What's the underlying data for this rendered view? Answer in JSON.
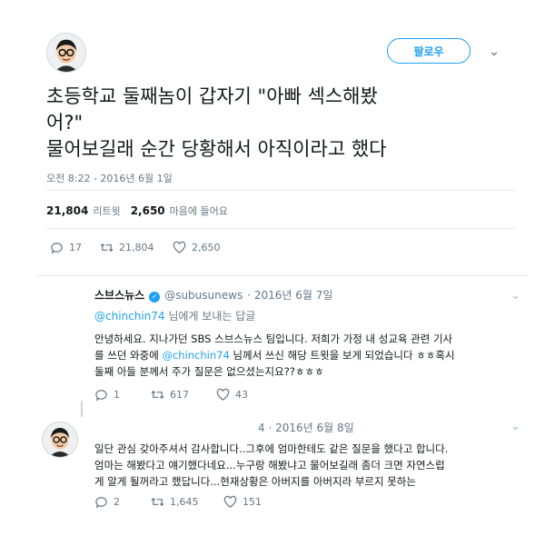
{
  "header": {
    "follow_label": "팔로우",
    "chevron_glyph": "⌄"
  },
  "tweet": {
    "text_lines": [
      "초등학교 둘째놈이 갑자기  \"아빠  섹스해봤",
      "어?\"",
      "물어보길래 순간 당황해서  아직이라고 했다"
    ],
    "timestamp": "오전 8:22 - 2016년 6월 1일",
    "stats": {
      "retweets": "21,804",
      "retweets_label": "리트윗",
      "likes": "2,650",
      "likes_label": "마음에 들어요"
    },
    "actions": {
      "replies": "17",
      "retweets": "21,804",
      "likes": "2,650"
    }
  },
  "reply1": {
    "name": "스브스뉴스",
    "handle": "@subusunews",
    "date": "· 2016년 6월 7일",
    "reply_to_user": "@chinchin74",
    "reply_to_suffix": " 님에게 보내는 답글",
    "body_line1": "안녕하세요. 지나가던 SBS 스브스뉴스 팀입니다. 저희가 가정 내 성교육 관련 기사",
    "body_line2_pre": "를 쓰던 와중에 ",
    "body_mention": "@chinchin74",
    "body_line2_post": " 님께서 쓰신 해당 트윗을 보게 되었습니다 ㅎㅎ혹시",
    "body_line3": "둘째 아들 분께서 주가 질문은 없으셨는지요??ㅎㅎㅎ",
    "actions": {
      "replies": "1",
      "retweets": "617",
      "likes": "43"
    }
  },
  "reply2": {
    "date": "4 · 2016년 6월 8일",
    "body_line1": "일단 관심 갖아주셔서 감사합니다..그후에 엄마한테도 같은 질문을 했다고 합니다.",
    "body_line2": "엄마는 해봤다고 얘기했다네요...누구랑 해봤냐고 물어보길래 좀더 크면 자연스럽",
    "body_line3": "게 알게 될꺼라고 했답니다...현재상황은 아버지를 아버지라 부르지 못하는",
    "actions": {
      "replies": "2",
      "retweets": "1,645",
      "likes": "151"
    }
  },
  "colors": {
    "accent": "#1da1f2",
    "text": "#14171a",
    "muted": "#657786",
    "divider": "#e1e8ed"
  }
}
